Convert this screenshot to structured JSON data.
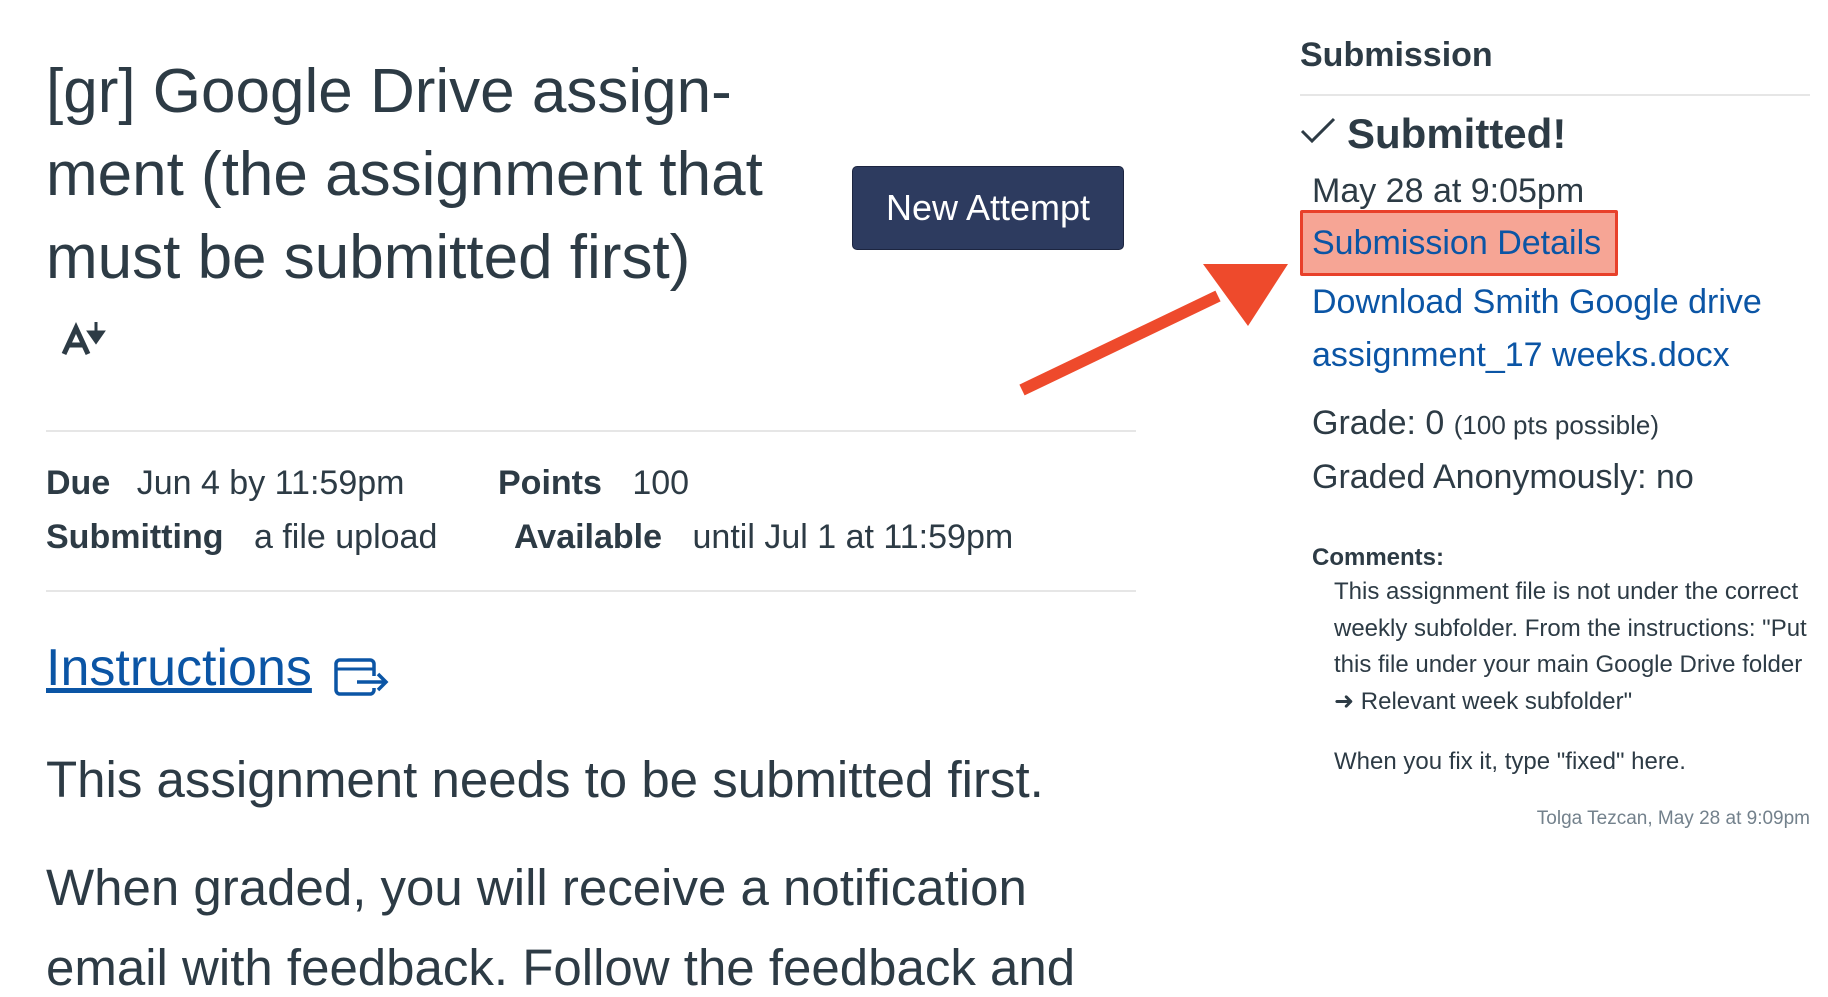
{
  "assignment": {
    "title_lines": [
      "[gr] Google Drive assign-",
      "ment (the assignment that",
      "must be submitted first)"
    ],
    "new_attempt_label": "New Attempt",
    "icons": {
      "a11y": "text-to-speech-icon",
      "external": "external-link-icon"
    },
    "details": {
      "due_label": "Due",
      "due_value": "Jun 4 by 11:59pm",
      "points_label": "Points",
      "points_value": "100",
      "submitting_label": "Submitting",
      "submitting_value": "a file upload",
      "available_label": "Available",
      "available_value": "until Jul 1 at 11:59pm"
    },
    "instructions_link": "Instructions",
    "body": [
      "This assignment needs to be submitted first.",
      "When graded, you will receive a notification",
      "email with feedback. Follow the feedback and"
    ]
  },
  "sidebar": {
    "heading": "Submission",
    "status": "Submitted!",
    "status_icon": "checkmark-icon",
    "submitted_date": "May 28 at 9:05pm",
    "details_link": "Submission Details",
    "download_link": "Download Smith Google drive assignment_17 weeks.docx",
    "grade_label": "Grade: 0",
    "grade_possible": "(100 pts possible)",
    "anonymous": "Graded Anonymously: no",
    "comments_label": "Comments:",
    "comment_paragraphs": [
      "This assignment file is not under the correct weekly subfolder. From the instructions: \"Put this file under your main Google Drive folder ➜ Relevant week subfolder\"",
      "When you fix it, type \"fixed\" here."
    ],
    "comment_meta": "Tolga Tezcan, May 28 at 9:09pm"
  },
  "colors": {
    "text": "#2d3b45",
    "link": "#0b55a5",
    "button": "#2d3b5f",
    "highlight_border": "#e8402a",
    "highlight_fill": "#f6a595",
    "arrow": "#ee4a2c"
  }
}
